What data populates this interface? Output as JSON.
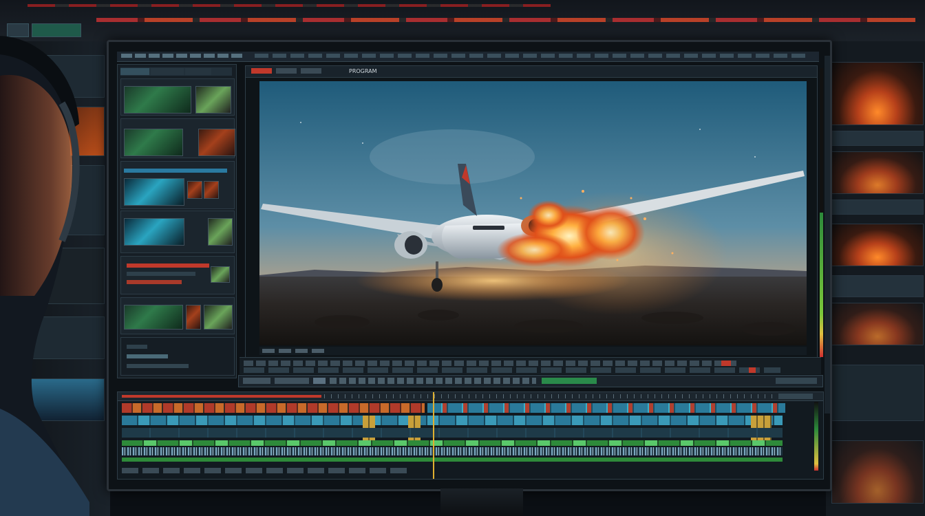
{
  "viewer": {
    "label": "PROGRAM"
  },
  "colors": {
    "accent_red": "#c0392b",
    "accent_orange": "#ff8a2a",
    "panel_bg": "#161e25",
    "sky_top": "#1f5b7a",
    "sky_bottom": "#e8a070"
  },
  "icons": {
    "play": "play-icon",
    "meter": "audio-meter-icon"
  }
}
